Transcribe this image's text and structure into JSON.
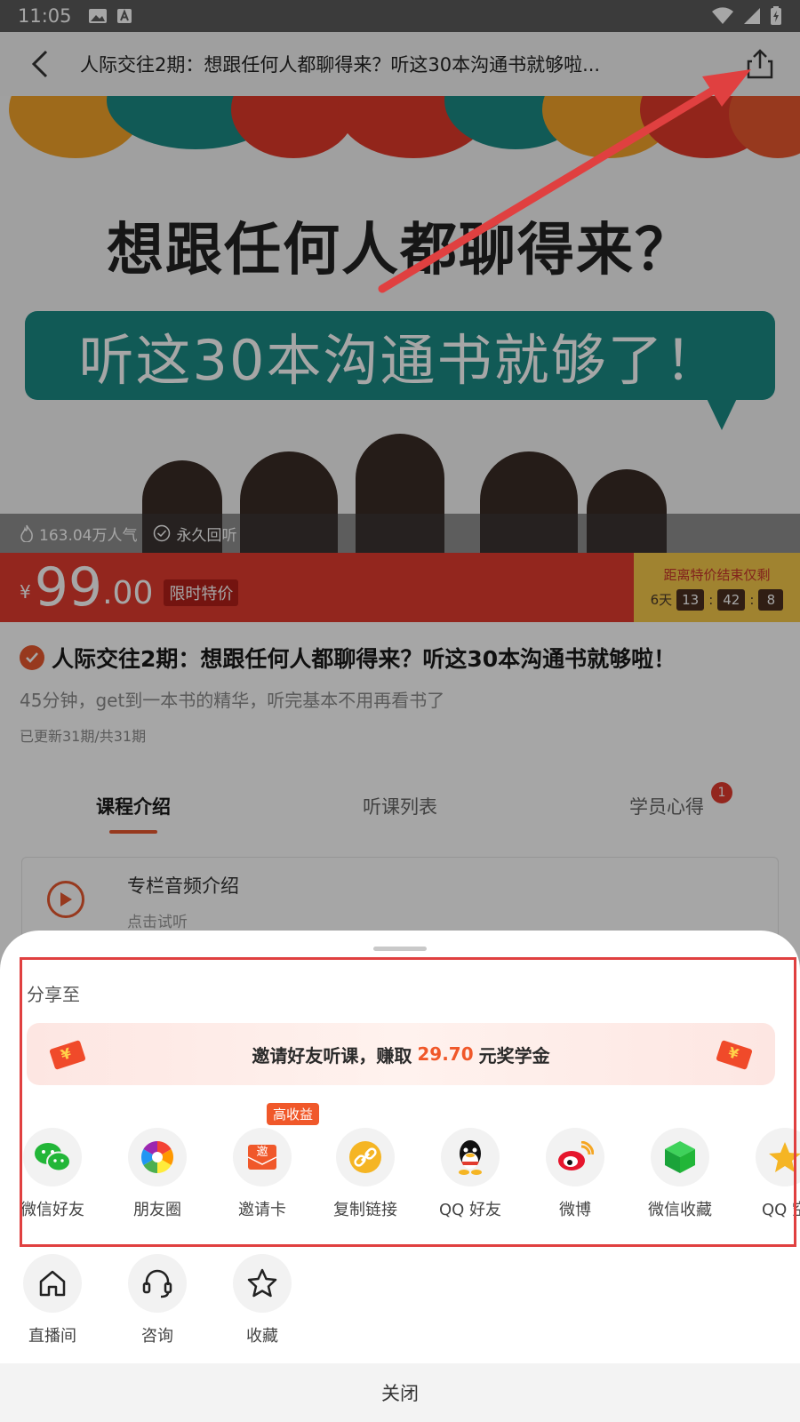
{
  "status_bar": {
    "time": "11:05"
  },
  "header": {
    "title": "人际交往2期：想跟任何人都聊得来？听这30本沟通书就够啦..."
  },
  "banner": {
    "headline": "想跟任何人都聊得来？",
    "subheadline": "听这30本沟通书就够了！",
    "popularity": "163.04万人气",
    "replay": "永久回听"
  },
  "price": {
    "currency": "¥",
    "integer": "99",
    "decimal": ".00",
    "tag": "限时特价",
    "countdown_label": "距离特价结束仅剩",
    "days": "6天",
    "hours": "13",
    "minutes": "42",
    "seconds": "8"
  },
  "course": {
    "name": "人际交往2期：想跟任何人都聊得来？听这30本沟通书就够啦！",
    "description": "45分钟，get到一本书的精华，听完基本不用再看书了",
    "periods": "已更新31期/共31期"
  },
  "tabs": [
    {
      "label": "课程介绍"
    },
    {
      "label": "听课列表"
    },
    {
      "label": "学员心得",
      "badge": "1"
    }
  ],
  "audio_card": {
    "title": "专栏音频介绍",
    "subtitle": "点击试听"
  },
  "share_sheet": {
    "heading": "分享至",
    "invite_prefix": "邀请好友听课，赚取",
    "invite_amount": "29.70",
    "invite_suffix": "元奖学金",
    "hot_badge": "高收益",
    "targets": [
      {
        "label": "微信好友",
        "icon": "wechat-icon"
      },
      {
        "label": "朋友圈",
        "icon": "moments-icon"
      },
      {
        "label": "邀请卡",
        "icon": "invite-card-icon"
      },
      {
        "label": "复制链接",
        "icon": "link-icon"
      },
      {
        "label": "QQ 好友",
        "icon": "qq-icon"
      },
      {
        "label": "微博",
        "icon": "weibo-icon"
      },
      {
        "label": "微信收藏",
        "icon": "wechat-favorite-icon"
      },
      {
        "label": "QQ 空",
        "icon": "qzone-icon"
      }
    ],
    "actions": [
      {
        "label": "直播间",
        "icon": "home-icon"
      },
      {
        "label": "咨询",
        "icon": "headset-icon"
      },
      {
        "label": "收藏",
        "icon": "star-icon"
      }
    ],
    "close_label": "关闭"
  },
  "colors": {
    "accent": "#e8582f",
    "price_red": "#e23b2e",
    "annotation_red": "#e04040"
  }
}
